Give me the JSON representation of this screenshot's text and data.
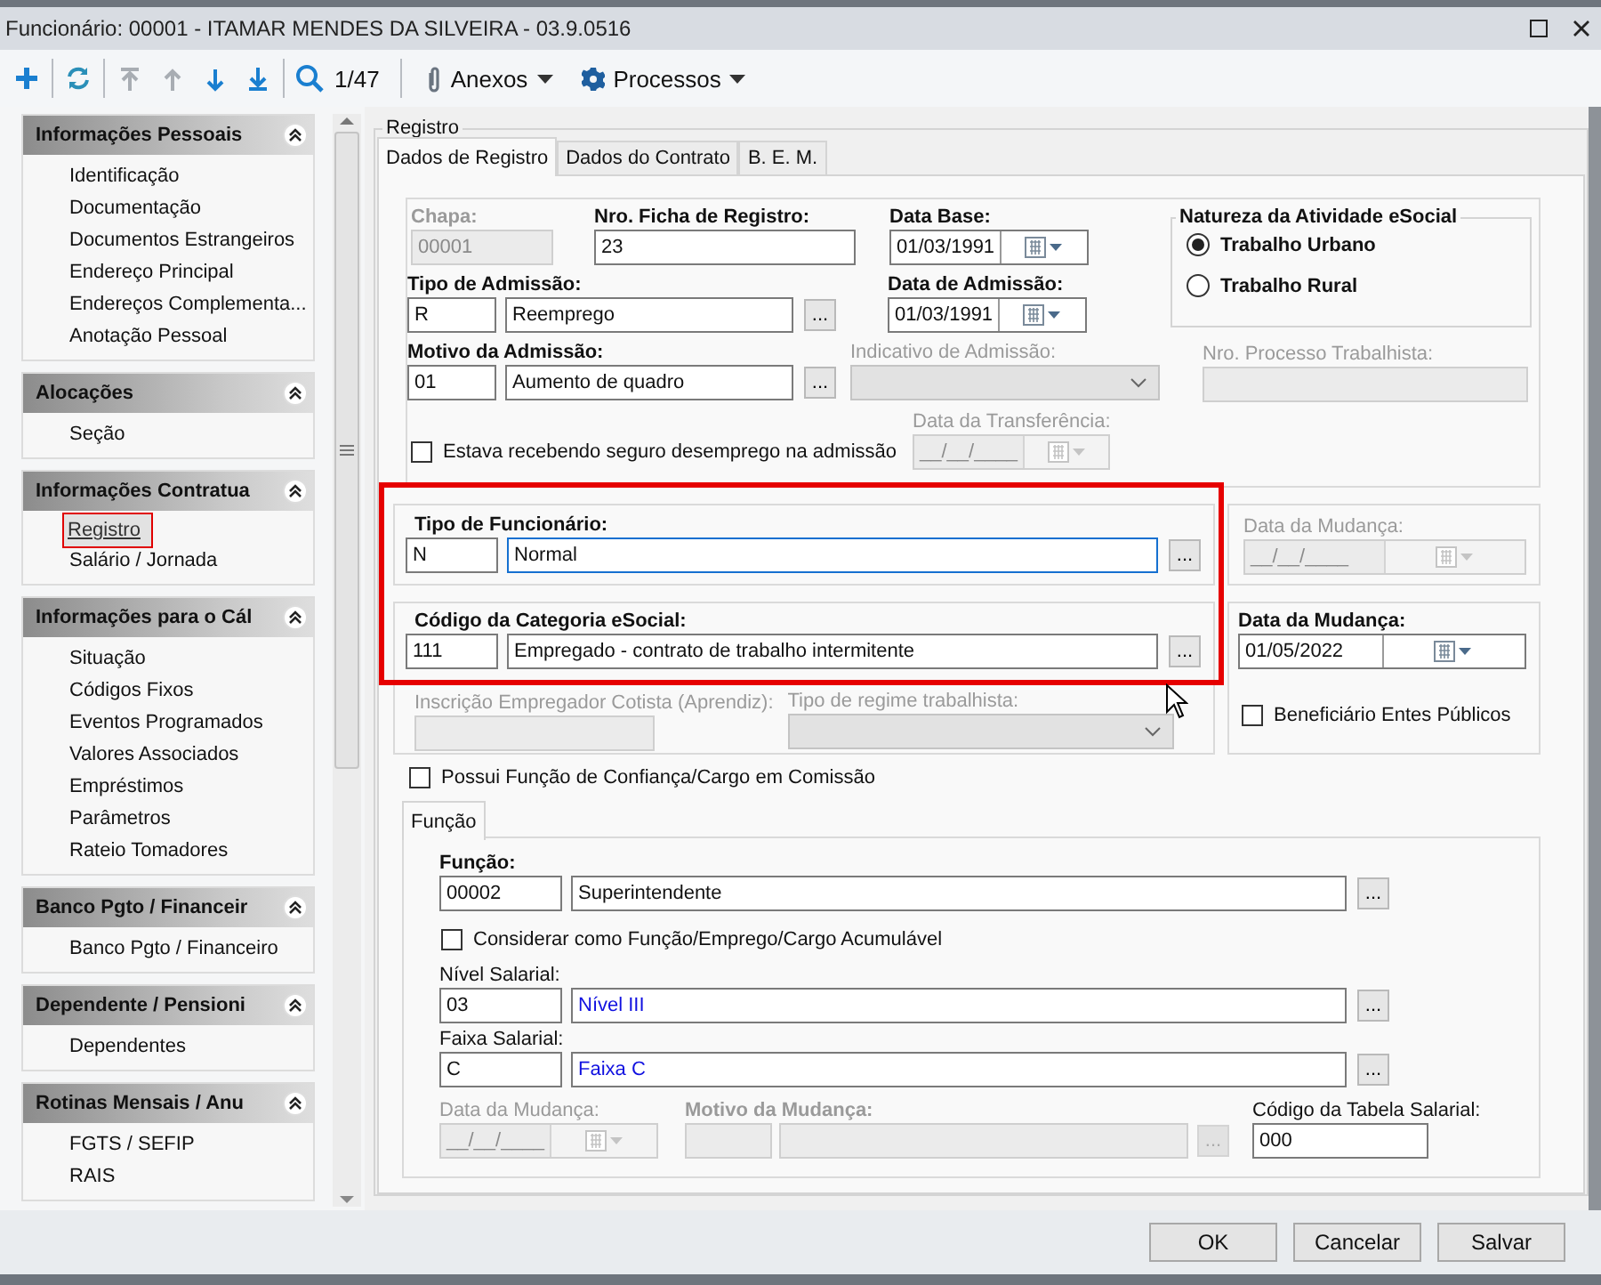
{
  "window": {
    "title": "Funcionário: 00001 - ITAMAR MENDES DA SILVEIRA - 03.9.0516"
  },
  "toolbar": {
    "nav_buttons": [
      {
        "disabled": true
      },
      {
        "disabled": true
      },
      {
        "disabled": false
      },
      {
        "disabled": false
      }
    ],
    "record_counter": "1/47",
    "menus": [
      {
        "label": "Anexos"
      },
      {
        "label": "Processos"
      }
    ]
  },
  "sidebar": {
    "sections": [
      {
        "title": "Informações Pessoais",
        "items": [
          {
            "label": "Identificação",
            "selected": false
          },
          {
            "label": "Documentação",
            "selected": false
          },
          {
            "label": "Documentos Estrangeiros",
            "selected": false
          },
          {
            "label": "Endereço Principal",
            "selected": false
          },
          {
            "label": "Endereços Complementa...",
            "selected": false
          },
          {
            "label": "Anotação Pessoal",
            "selected": false
          }
        ]
      },
      {
        "title": "Alocações",
        "items": [
          {
            "label": "Seção",
            "selected": false
          }
        ]
      },
      {
        "title": "Informações Contratua",
        "items": [
          {
            "label": "Registro",
            "selected": true
          },
          {
            "label": "Salário / Jornada",
            "selected": false
          }
        ]
      },
      {
        "title": "Informações para o Cál",
        "items": [
          {
            "label": "Situação",
            "selected": false
          },
          {
            "label": "Códigos Fixos",
            "selected": false
          },
          {
            "label": "Eventos Programados",
            "selected": false
          },
          {
            "label": "Valores Associados",
            "selected": false
          },
          {
            "label": "Empréstimos",
            "selected": false
          },
          {
            "label": "Parâmetros",
            "selected": false
          },
          {
            "label": "Rateio Tomadores",
            "selected": false
          }
        ]
      },
      {
        "title": "Banco Pgto / Financeir",
        "items": [
          {
            "label": "Banco Pgto / Financeiro",
            "selected": false
          }
        ]
      },
      {
        "title": "Dependente / Pensioni",
        "items": [
          {
            "label": "Dependentes",
            "selected": false
          }
        ]
      },
      {
        "title": "Rotinas Mensais / Anu",
        "items": [
          {
            "label": "FGTS / SEFIP",
            "selected": false
          },
          {
            "label": "RAIS",
            "selected": false
          }
        ]
      }
    ]
  },
  "group_title": "Registro",
  "tabs": [
    {
      "label": "Dados de Registro",
      "selected": true
    },
    {
      "label": "Dados do Contrato",
      "selected": false
    },
    {
      "label": "B. E. M.",
      "selected": false
    }
  ],
  "registro_panel": {
    "chapa": {
      "label": "Chapa:",
      "value": "00001",
      "required": true,
      "disabled": true
    },
    "ficha": {
      "label": "Nro. Ficha de Registro:",
      "value": "23",
      "required": true,
      "disabled": false
    },
    "data_base": {
      "label": "Data Base:",
      "value": "01/03/1991",
      "required": true,
      "disabled": false
    },
    "tipo_admissao": {
      "label": "Tipo de Admissão:",
      "code": "R",
      "description": "Reemprego",
      "button": "...",
      "required": true,
      "disabled": false
    },
    "data_admissao": {
      "label": "Data de Admissão:",
      "value": "01/03/1991",
      "required": true,
      "disabled": false
    },
    "motivo_admissao": {
      "label": "Motivo da Admissão:",
      "code": "01",
      "description": "Aumento de quadro",
      "button": "...",
      "required": true,
      "disabled": false
    },
    "indicativo_admissao": {
      "label": "Indicativo de Admissão:",
      "required": false,
      "disabled": true
    },
    "seguro_desemprego": {
      "label": "Estava recebendo seguro desemprego na admissão",
      "checked": false
    },
    "data_transferencia": {
      "label": "Data da Transferência:",
      "value": "__/__/____",
      "required": false,
      "disabled": true
    },
    "natureza": {
      "title": "Natureza da Atividade eSocial",
      "options": [
        {
          "label": "Trabalho Urbano",
          "selected": true
        },
        {
          "label": "Trabalho Rural",
          "selected": false
        }
      ]
    },
    "nro_processo": {
      "label": "Nro. Processo Trabalhista:",
      "required": false,
      "disabled": true
    }
  },
  "highlight_frame": true,
  "tipo_funcionario": {
    "label": "Tipo de Funcionário:",
    "code": "N",
    "description": "Normal",
    "button": "...",
    "required": true,
    "disabled": false,
    "focused": true
  },
  "mudanca_tipo": {
    "label": "Data da Mudança:",
    "value": "__/__/____",
    "required": false,
    "disabled": true
  },
  "categoria_esocial": {
    "label": "Código da Categoria eSocial:",
    "code": "111",
    "description": "Empregado - contrato de trabalho intermitente",
    "button": "...",
    "required": true,
    "disabled": false,
    "focused": false
  },
  "mudanca_categoria": {
    "label": "Data da Mudança:",
    "value": "01/05/2022",
    "required": true,
    "disabled": false
  },
  "inscricao_cotista": {
    "label": "Inscrição Empregador Cotista (Aprendiz):",
    "required": false,
    "disabled": true
  },
  "regime_trabalhista": {
    "label": "Tipo de regime trabalhista:",
    "required": false,
    "disabled": true
  },
  "beneficiario": {
    "label": "Beneficiário Entes Públicos",
    "checked": false
  },
  "funcao_confianca": {
    "label": "Possui Função de Confiança/Cargo em Comissão",
    "checked": false
  },
  "funcao_tabs": [
    {
      "label": "Função",
      "selected": true
    }
  ],
  "funcao": {
    "label": "Função:",
    "code": "00002",
    "description": "Superintendente",
    "button": "...",
    "required": true,
    "disabled": false,
    "emphasis": false
  },
  "acumulavel": {
    "label": "Considerar como Função/Emprego/Cargo Acumulável",
    "checked": false
  },
  "nivel_salarial": {
    "label": "Nível Salarial:",
    "code": "03",
    "description": "Nível III",
    "button": "...",
    "required": false,
    "disabled": false,
    "emphasis": true
  },
  "faixa_salarial": {
    "label": "Faixa Salarial:",
    "code": "C",
    "description": "Faixa C",
    "button": "...",
    "required": false,
    "disabled": false,
    "emphasis": true
  },
  "data_mudanca_funcao": {
    "label": "Data da Mudança:",
    "value": "__/__/____",
    "required": false,
    "disabled": true
  },
  "motivo_mudanca": {
    "label": "Motivo da Mudança:",
    "button": "...",
    "required": true,
    "disabled": true
  },
  "codigo_tabela": {
    "label": "Código da Tabela Salarial:",
    "value": "000",
    "required": false,
    "disabled": false
  },
  "buttons": [
    {
      "label": "OK"
    },
    {
      "label": "Cancelar"
    },
    {
      "label": "Salvar"
    }
  ]
}
